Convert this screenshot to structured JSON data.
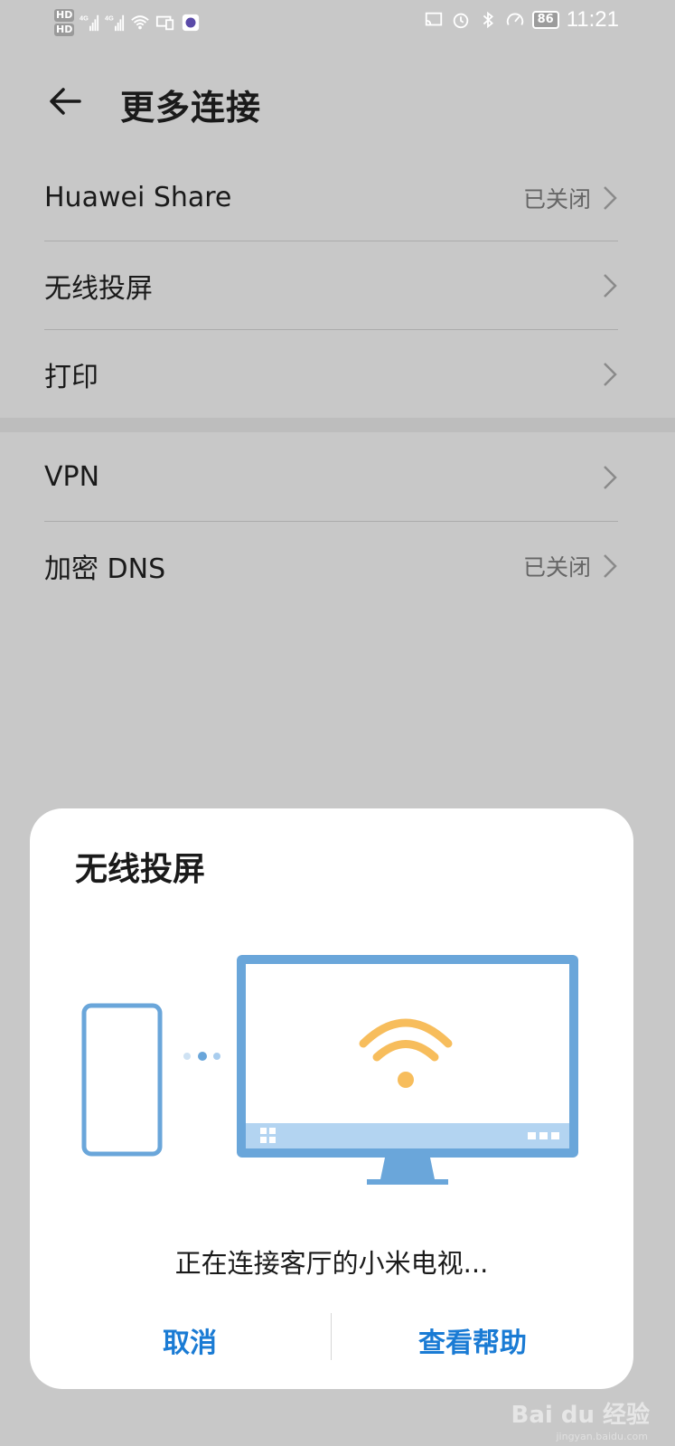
{
  "status_bar": {
    "hd_top": "HD",
    "hd_bottom": "HD",
    "sig1": "4G",
    "sig2": "4G",
    "battery": "86",
    "time": "11:21"
  },
  "header": {
    "title": "更多连接"
  },
  "list": {
    "section1": [
      {
        "label": "Huawei Share",
        "state": "已关闭"
      },
      {
        "label": "无线投屏",
        "state": ""
      },
      {
        "label": "打印",
        "state": ""
      }
    ],
    "section2": [
      {
        "label": "VPN",
        "state": ""
      },
      {
        "label": "加密 DNS",
        "state": "已关闭"
      }
    ]
  },
  "dialog": {
    "title": "无线投屏",
    "message": "正在连接客厅的小米电视...",
    "cancel_label": "取消",
    "help_label": "查看帮助"
  },
  "colors": {
    "accent": "#1a7bd4",
    "illustration_blue": "#6aa6da",
    "wifi_orange": "#f7bd5c"
  },
  "watermark": {
    "brand": "Bai du 经验",
    "url": "jingyan.baidu.com"
  }
}
